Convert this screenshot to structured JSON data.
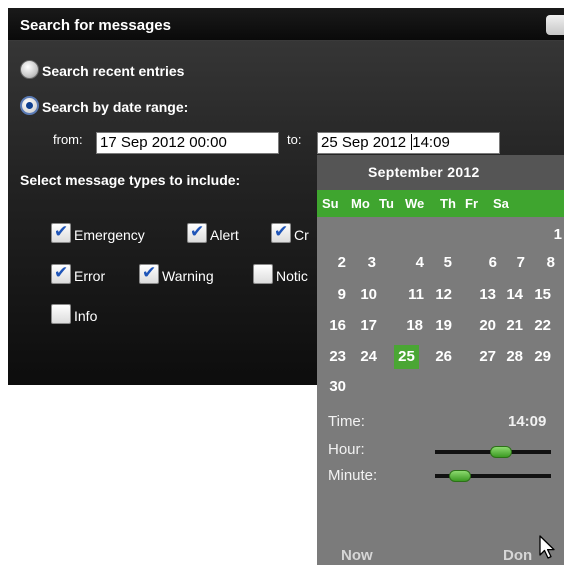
{
  "dialog": {
    "title": "Search for messages",
    "radio_recent": "Search recent entries",
    "radio_range": "Search by date range:",
    "from_label": "from:",
    "from_value": "17 Sep 2012 00:00",
    "to_label": "to:",
    "to_value_before_caret": "25 Sep 2012 ",
    "to_value_after_caret": "14:09",
    "types_label": "Select message types to include:",
    "types": [
      {
        "label": "Emergency",
        "checked": true
      },
      {
        "label": "Alert",
        "checked": true
      },
      {
        "label": "Cr",
        "checked": true
      },
      {
        "label": "Error",
        "checked": true
      },
      {
        "label": "Warning",
        "checked": true
      },
      {
        "label": "Notic",
        "checked": false
      },
      {
        "label": "Info",
        "checked": false
      }
    ]
  },
  "calendar": {
    "month_title": "September 2012",
    "weekdays": [
      "Su",
      "Mo",
      "Tu",
      "We",
      "Th",
      "Fr",
      "Sa"
    ],
    "days": [
      "1",
      "2",
      "3",
      "4",
      "5",
      "6",
      "7",
      "8",
      "9",
      "10",
      "11",
      "12",
      "13",
      "14",
      "15",
      "16",
      "17",
      "18",
      "19",
      "20",
      "21",
      "22",
      "23",
      "24",
      "25",
      "26",
      "27",
      "28",
      "29",
      "30"
    ],
    "selected_day": "25",
    "time_label": "Time:",
    "time_value": "14:09",
    "hour_label": "Hour:",
    "minute_label": "Minute:",
    "hour_fraction": 0.58,
    "minute_fraction": 0.15,
    "now_button": "Now",
    "done_button": "Don"
  },
  "colors": {
    "accent_green": "#3fa52f",
    "calendar_bg": "#7b7b7b",
    "check_blue": "#1f55b8"
  }
}
